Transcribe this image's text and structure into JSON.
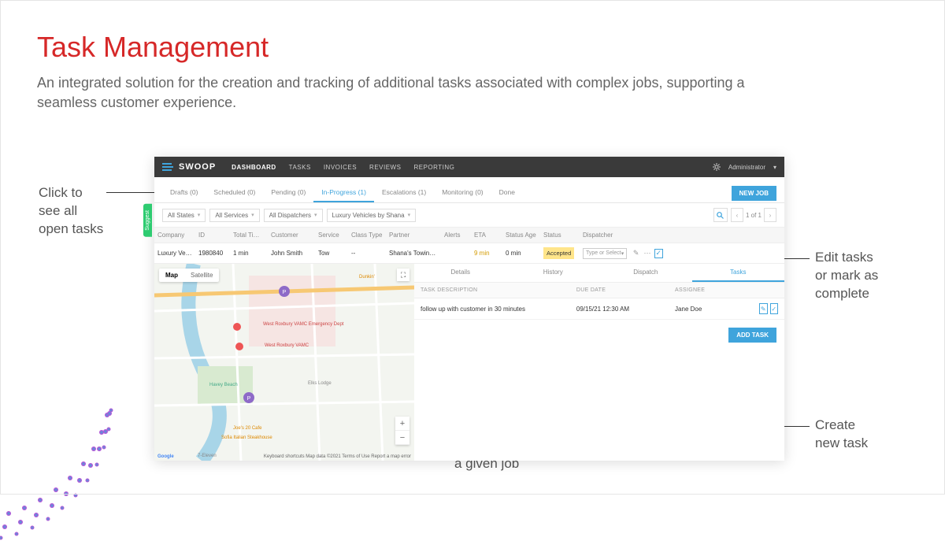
{
  "hero": {
    "title": "Task Management",
    "subtitle": "An integrated solution for the creation and tracking of additional tasks associated with complex jobs, supporting a seamless customer experience."
  },
  "annotations": {
    "open_tasks": "Click to\nsee all\nopen tasks",
    "view_tasks": "View open tasks\nassociated with\na given job",
    "edit_tasks": "Edit tasks\nor mark as\ncomplete",
    "create_task": "Create\nnew task"
  },
  "app": {
    "logo": "SWOOP",
    "nav": [
      "DASHBOARD",
      "TASKS",
      "INVOICES",
      "REVIEWS",
      "REPORTING"
    ],
    "nav_active": 0,
    "user": "Administrator",
    "new_job": "NEW JOB",
    "tabs": [
      {
        "label": "Drafts (0)"
      },
      {
        "label": "Scheduled (0)"
      },
      {
        "label": "Pending (0)"
      },
      {
        "label": "In-Progress (1)",
        "active": true
      },
      {
        "label": "Escalations (1)"
      },
      {
        "label": "Monitoring (0)"
      },
      {
        "label": "Done"
      }
    ],
    "filters": [
      "All States",
      "All Services",
      "All Dispatchers",
      "Luxury Vehicles by Shana"
    ],
    "pager": {
      "text": "1 of 1"
    },
    "columns": [
      "Company",
      "ID",
      "Total Time",
      "Customer",
      "Service",
      "Class Type",
      "Partner",
      "Alerts",
      "ETA",
      "Status Age",
      "Status",
      "Dispatcher"
    ],
    "row": {
      "company": "Luxury Veh…",
      "id": "1980840",
      "time": "1 min",
      "customer": "John Smith",
      "service": "Tow",
      "class": "--",
      "partner": "Shana's Towing C…",
      "alerts": "",
      "eta": "9 min",
      "age": "0 min",
      "status": "Accepted",
      "dispatcher_placeholder": "Type or Select"
    },
    "map": {
      "toggles": [
        "Map",
        "Satellite"
      ],
      "credits_left": "Google",
      "credits_mid": "Keyboard shortcuts   Map data ©2021   Terms of Use   Report a map error",
      "pois": [
        "West Roxbury VAMC Emergency Dept",
        "West Roxbury VAMC",
        "Havey Beach",
        "Elks Lodge",
        "Joe's 20 Cafe",
        "Sofia Italian Steakhouse",
        "Dunkin'",
        "7-Eleven"
      ]
    },
    "feedback_tab": "Suggest",
    "detail_tabs": [
      "Details",
      "History",
      "Dispatch",
      "Tasks"
    ],
    "detail_active": 3,
    "task_columns": [
      "TASK DESCRIPTION",
      "DUE DATE",
      "ASSIGNEE"
    ],
    "task": {
      "desc": "follow up with customer in 30 minutes",
      "due": "09/15/21 12:30 AM",
      "assignee": "Jane Doe"
    },
    "add_task": "ADD TASK"
  }
}
